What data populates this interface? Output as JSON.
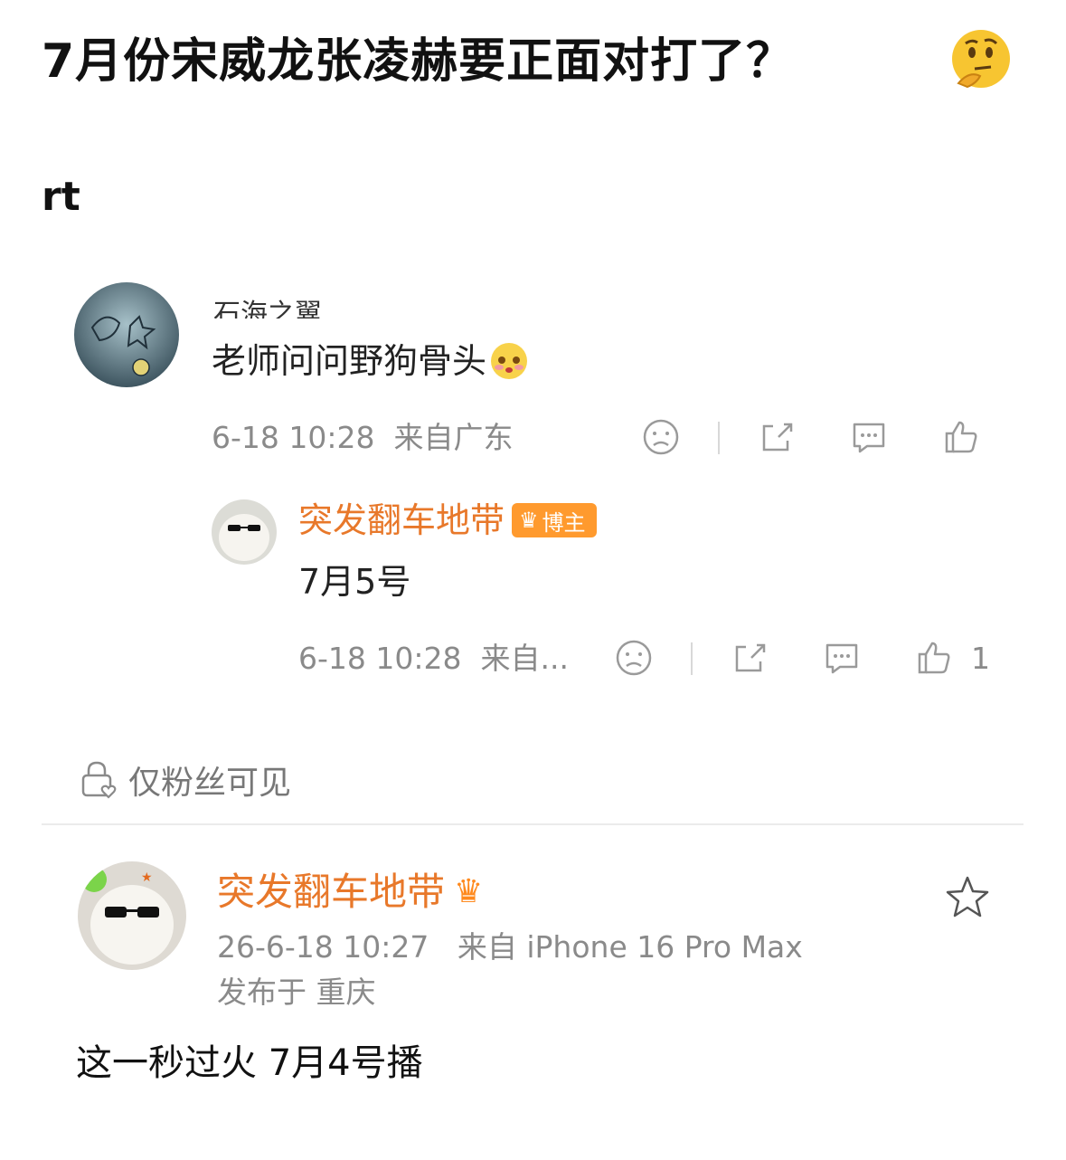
{
  "post": {
    "title": "7月份宋威龙张凌赫要正面对打了？",
    "title_emoji": "thinking-face",
    "body": "rt"
  },
  "comment": {
    "author_partial": "石海之翼",
    "text": "老师问问野狗骨头",
    "time": "6-18 10:28",
    "location": "来自广东",
    "icons": [
      "dislike-icon",
      "share-icon",
      "comment-icon",
      "like-icon"
    ]
  },
  "reply": {
    "author": "突发翻车地带",
    "badge": "博主",
    "text": "7月5号",
    "time": "6-18 10:28",
    "location": "来自...",
    "like_count": "1"
  },
  "visibility": {
    "label": "仅粉丝可见"
  },
  "blogger_post": {
    "author": "突发翻车地带",
    "time": "26-6-18 10:27",
    "device": "来自 iPhone 16 Pro Max",
    "published_at": "发布于 重庆",
    "text": "这一秒过火 7月4号播"
  },
  "colors": {
    "accent_orange": "#e8782a",
    "meta_gray": "#8a8a8a",
    "badge_orange": "#ff9a2e"
  }
}
